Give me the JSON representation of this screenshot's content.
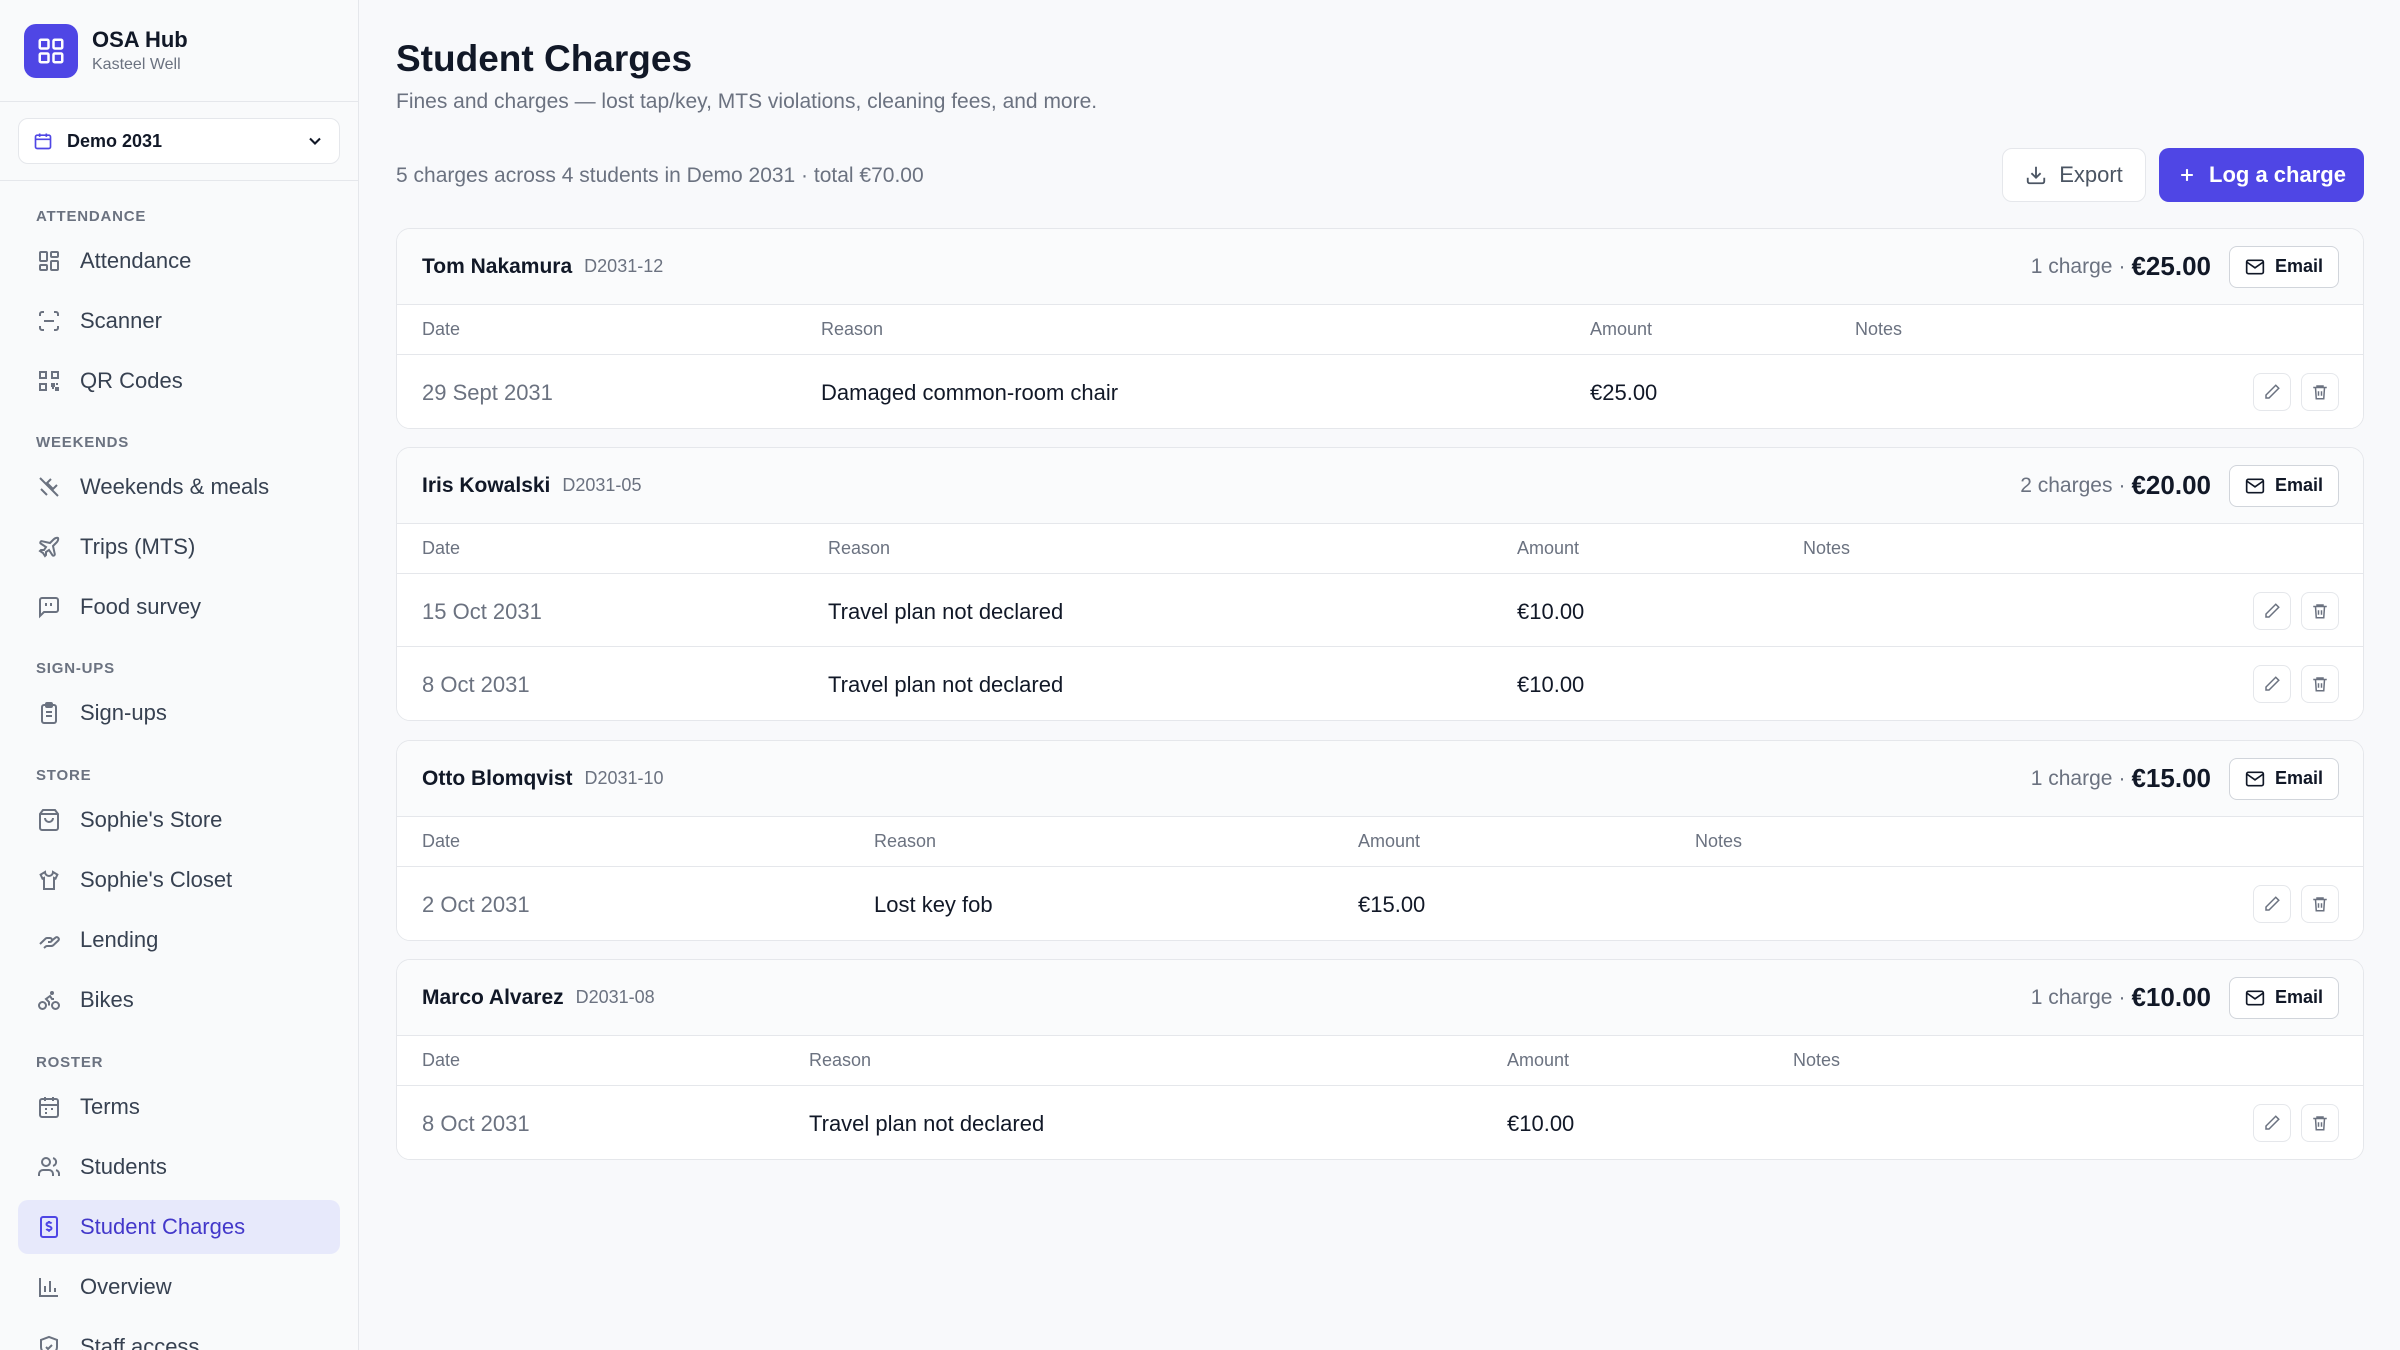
{
  "brand": {
    "name": "OSA Hub",
    "subtitle": "Kasteel Well"
  },
  "term_selector": {
    "value": "Demo 2031"
  },
  "sidebar": {
    "sections": [
      {
        "label": "ATTENDANCE",
        "items": [
          {
            "label": "Attendance",
            "icon": "grid-icon"
          },
          {
            "label": "Scanner",
            "icon": "scan-icon"
          },
          {
            "label": "QR Codes",
            "icon": "qr-code-icon"
          }
        ]
      },
      {
        "label": "WEEKENDS",
        "items": [
          {
            "label": "Weekends & meals",
            "icon": "utensils-icon"
          },
          {
            "label": "Trips (MTS)",
            "icon": "plane-icon"
          },
          {
            "label": "Food survey",
            "icon": "message-square-icon"
          }
        ]
      },
      {
        "label": "SIGN-UPS",
        "items": [
          {
            "label": "Sign-ups",
            "icon": "clipboard-icon"
          }
        ]
      },
      {
        "label": "STORE",
        "items": [
          {
            "label": "Sophie's Store",
            "icon": "shopping-bag-icon"
          },
          {
            "label": "Sophie's Closet",
            "icon": "shirt-icon"
          },
          {
            "label": "Lending",
            "icon": "hand-icon"
          },
          {
            "label": "Bikes",
            "icon": "bike-icon"
          }
        ]
      },
      {
        "label": "ROSTER",
        "items": [
          {
            "label": "Terms",
            "icon": "calendar-icon"
          },
          {
            "label": "Students",
            "icon": "users-icon"
          },
          {
            "label": "Student Charges",
            "icon": "receipt-icon",
            "active": true
          },
          {
            "label": "Overview",
            "icon": "bar-chart-icon"
          },
          {
            "label": "Staff access",
            "icon": "shield-icon"
          }
        ]
      }
    ]
  },
  "page": {
    "title": "Student Charges",
    "subtitle": "Fines and charges — lost tap/key, MTS violations, cleaning fees, and more.",
    "summary": "5 charges across 4 students in Demo 2031 · total €70.00",
    "export_label": "Export",
    "log_label": "Log a charge"
  },
  "table_headers": {
    "date": "Date",
    "reason": "Reason",
    "amount": "Amount",
    "notes": "Notes"
  },
  "email_label": "Email",
  "students": [
    {
      "name": "Tom Nakamura",
      "id": "D2031-12",
      "count": "1 charge",
      "total": "€25.00",
      "charges": [
        {
          "date": "29 Sept 2031",
          "reason": "Damaged common-room chair",
          "amount": "€25.00",
          "notes": ""
        }
      ]
    },
    {
      "name": "Iris Kowalski",
      "id": "D2031-05",
      "count": "2 charges",
      "total": "€20.00",
      "charges": [
        {
          "date": "15 Oct 2031",
          "reason": "Travel plan not declared",
          "amount": "€10.00",
          "notes": ""
        },
        {
          "date": "8 Oct 2031",
          "reason": "Travel plan not declared",
          "amount": "€10.00",
          "notes": ""
        }
      ]
    },
    {
      "name": "Otto Blomqvist",
      "id": "D2031-10",
      "count": "1 charge",
      "total": "€15.00",
      "charges": [
        {
          "date": "2 Oct 2031",
          "reason": "Lost key fob",
          "amount": "€15.00",
          "notes": ""
        }
      ]
    },
    {
      "name": "Marco Alvarez",
      "id": "D2031-08",
      "count": "1 charge",
      "total": "€10.00",
      "charges": [
        {
          "date": "8 Oct 2031",
          "reason": "Travel plan not declared",
          "amount": "€10.00",
          "notes": ""
        }
      ]
    }
  ],
  "colors": {
    "accent": "#4f46e5",
    "active_bg": "#e7e9fb"
  }
}
